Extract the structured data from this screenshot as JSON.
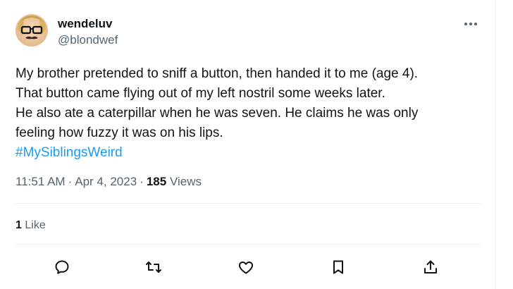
{
  "author": {
    "display_name": "wendeluv",
    "handle": "@blondwef",
    "avatar_icon": "profile-photo-mustache-glasses"
  },
  "more_menu": {
    "icon": "more-horizontal-icon",
    "label": "···"
  },
  "tweet": {
    "lines": [
      "My brother pretended to sniff a button, then handed it to me (age 4).",
      "That button came flying out of my left nostril some weeks later.",
      "He also ate a caterpillar when he was seven. He claims he was only",
      "feeling how fuzzy it was on his lips."
    ],
    "hashtag": "#MySiblingsWeird",
    "hashtag_color": "#1d9bf0"
  },
  "meta": {
    "time": "11:51 AM",
    "separator": "·",
    "date": "Apr 4, 2023",
    "views_count": "185",
    "views_label": "Views"
  },
  "engagement": {
    "likes_count": "1",
    "likes_label": "Like"
  },
  "actions": [
    {
      "name": "reply",
      "icon": "reply-icon"
    },
    {
      "name": "retweet",
      "icon": "retweet-icon"
    },
    {
      "name": "like",
      "icon": "heart-icon"
    },
    {
      "name": "bookmark",
      "icon": "bookmark-icon"
    },
    {
      "name": "share",
      "icon": "share-icon"
    }
  ],
  "colors": {
    "text_primary": "#0f1419",
    "text_secondary": "#536471",
    "accent": "#1d9bf0",
    "divider": "#eff3f4"
  }
}
